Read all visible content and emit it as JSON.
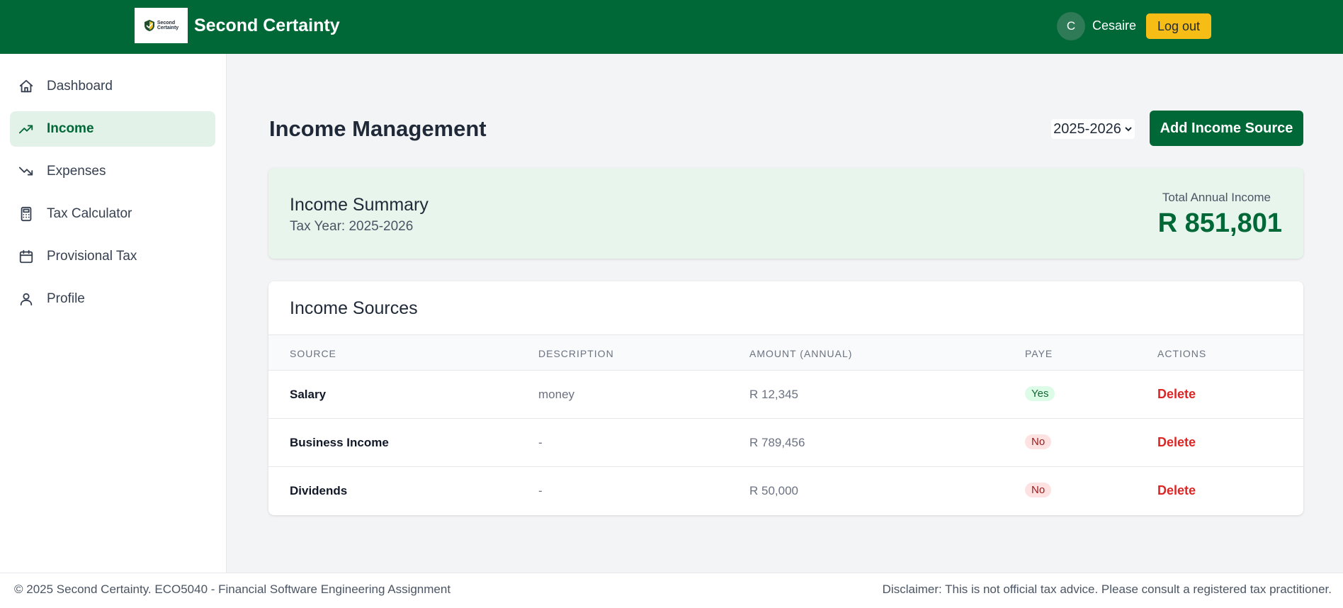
{
  "header": {
    "logo_text_1": "Second",
    "logo_text_2": "Certainty",
    "brand": "Second Certainty",
    "avatar_initial": "C",
    "username": "Cesaire",
    "logout_label": "Log out"
  },
  "sidebar": {
    "items": [
      {
        "label": "Dashboard",
        "icon": "home-icon"
      },
      {
        "label": "Income",
        "icon": "trending-up-icon",
        "active": true
      },
      {
        "label": "Expenses",
        "icon": "trending-down-icon"
      },
      {
        "label": "Tax Calculator",
        "icon": "calculator-icon"
      },
      {
        "label": "Provisional Tax",
        "icon": "calendar-icon"
      },
      {
        "label": "Profile",
        "icon": "user-icon"
      }
    ]
  },
  "main": {
    "title": "Income Management",
    "year_selected": "2025-2026",
    "add_button": "Add Income Source"
  },
  "summary": {
    "title": "Income Summary",
    "tax_year": "Tax Year: 2025-2026",
    "total_label": "Total Annual Income",
    "total_value": "R 851,801"
  },
  "sources": {
    "title": "Income Sources",
    "columns": [
      "SOURCE",
      "DESCRIPTION",
      "AMOUNT (ANNUAL)",
      "PAYE",
      "ACTIONS"
    ],
    "rows": [
      {
        "source": "Salary",
        "description": "money",
        "amount": "R 12,345",
        "paye": "Yes",
        "action": "Delete"
      },
      {
        "source": "Business Income",
        "description": "-",
        "amount": "R 789,456",
        "paye": "No",
        "action": "Delete"
      },
      {
        "source": "Dividends",
        "description": "-",
        "amount": "R 50,000",
        "paye": "No",
        "action": "Delete"
      }
    ]
  },
  "footer": {
    "left": "© 2025 Second Certainty. ECO5040 - Financial Software Engineering Assignment",
    "right": "Disclaimer: This is not official tax advice. Please consult a registered tax practitioner."
  },
  "colors": {
    "brand_green": "#006837",
    "accent_yellow": "#f6bd16",
    "danger_red": "#dc2626"
  }
}
